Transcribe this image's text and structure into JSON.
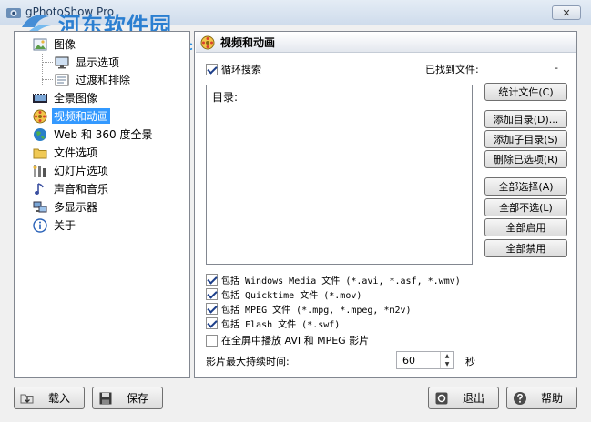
{
  "window": {
    "title": "gPhotoShow Pro",
    "close_label": "✕"
  },
  "watermark": {
    "main": "河东软件园",
    "sub": "www.pc0359.cn"
  },
  "tree": {
    "items": [
      {
        "label": "图像",
        "icon": "image-icon"
      },
      {
        "label": "显示选项",
        "icon": "display-icon"
      },
      {
        "label": "过渡和排除",
        "icon": "transition-icon"
      },
      {
        "label": "全景图像",
        "icon": "film-icon"
      },
      {
        "label": "视频和动画",
        "icon": "video-icon",
        "selected": true
      },
      {
        "label": "Web 和 360 度全景",
        "icon": "globe-icon"
      },
      {
        "label": "文件选项",
        "icon": "folder-icon"
      },
      {
        "label": "幻灯片选项",
        "icon": "slideshow-icon"
      },
      {
        "label": "声音和音乐",
        "icon": "music-icon"
      },
      {
        "label": "多显示器",
        "icon": "monitors-icon"
      },
      {
        "label": "关于",
        "icon": "info-icon"
      }
    ]
  },
  "panel": {
    "title": "视频和动画",
    "loop_search_label": "循环搜索",
    "found_files_label": "已找到文件:",
    "found_files_value": "-",
    "dir_label": "目录:",
    "buttons": {
      "count_files": "统计文件(C)",
      "add_dir": "添加目录(D)...",
      "add_subdir": "添加子目录(S)",
      "delete_selected": "删除已选项(R)",
      "select_all": "全部选择(A)",
      "select_none": "全部不选(L)",
      "enable_all": "全部启用",
      "disable_all": "全部禁用"
    },
    "options": [
      {
        "label": "包括 Windows Media 文件 (*.avi, *.asf, *.wmv)",
        "checked": true
      },
      {
        "label": "包括 Quicktime 文件 (*.mov)",
        "checked": true
      },
      {
        "label": "包括 MPEG 文件 (*.mpg, *.mpeg, *m2v)",
        "checked": true
      },
      {
        "label": "包括 Flash 文件 (*.swf)",
        "checked": true
      },
      {
        "label": "在全屏中播放 AVI 和 MPEG 影片",
        "checked": false
      }
    ],
    "max_duration_label": "影片最大持续时间:",
    "max_duration_value": "60",
    "seconds_label": "秒"
  },
  "bottom": {
    "load": "载入",
    "save": "保存",
    "exit": "退出",
    "help": "帮助"
  }
}
